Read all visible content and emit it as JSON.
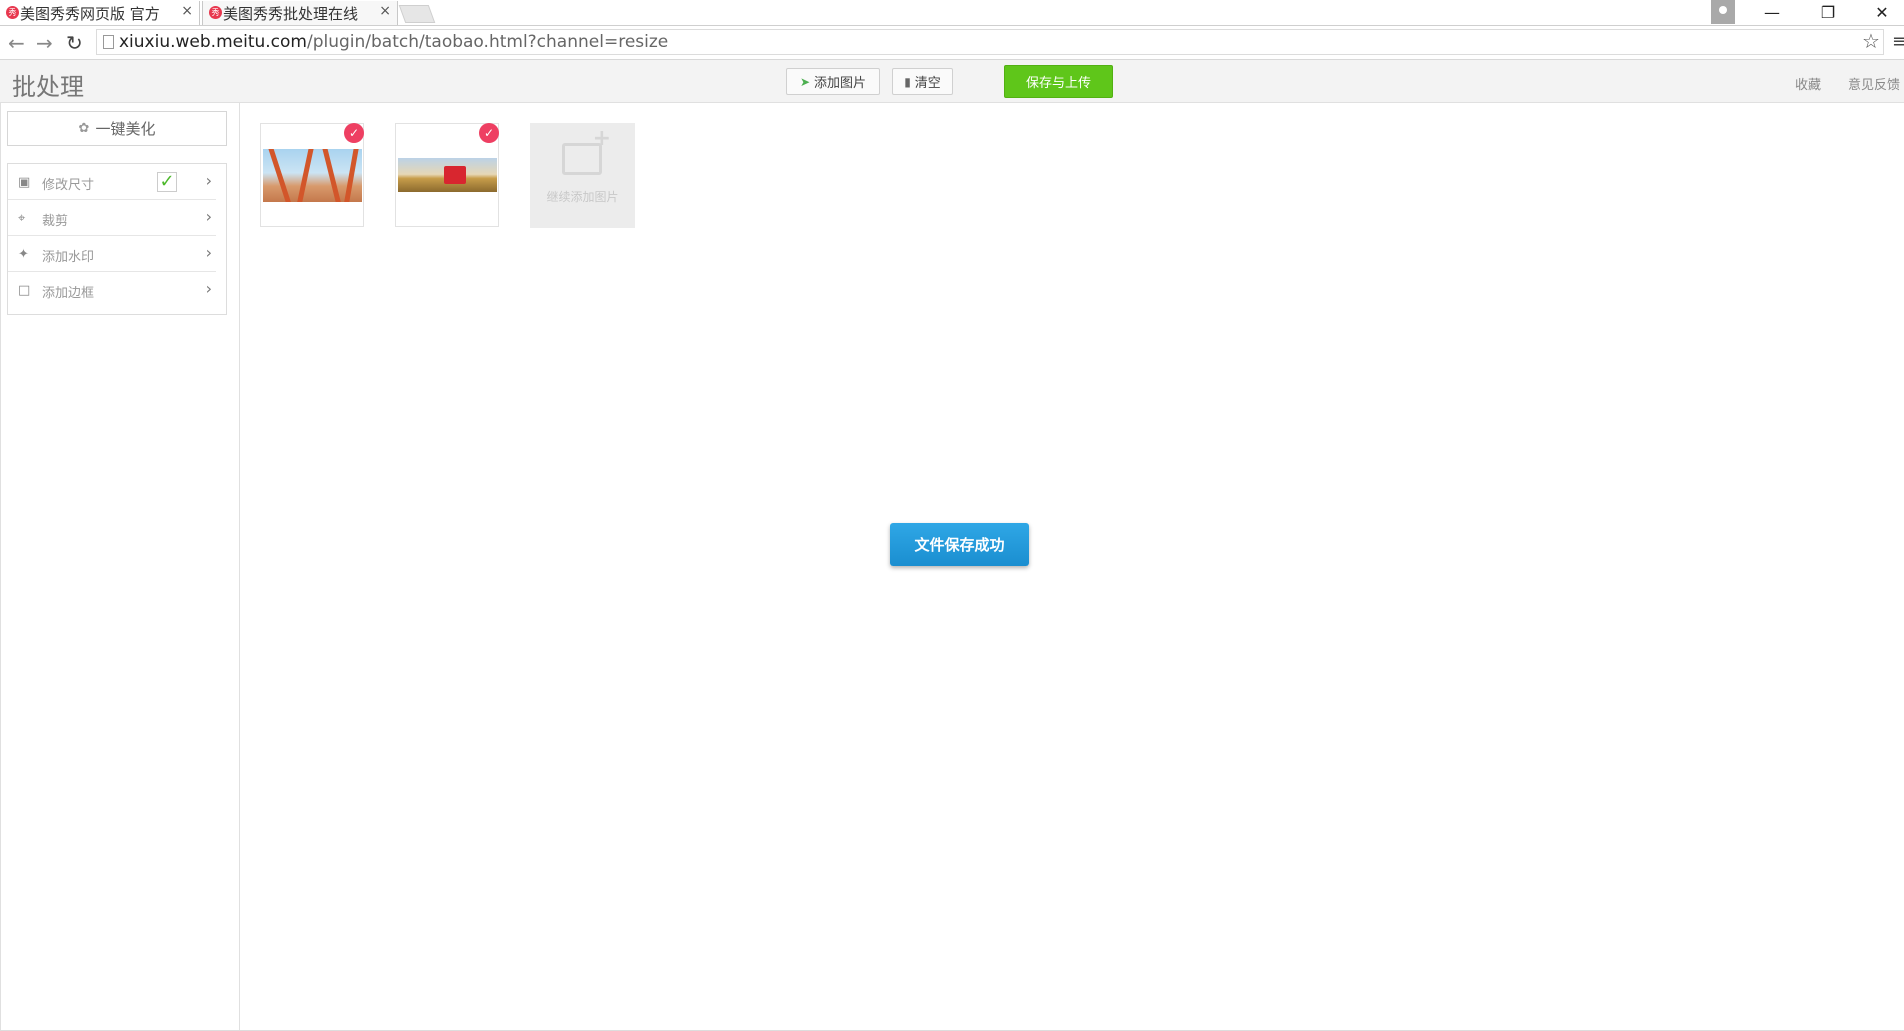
{
  "browser": {
    "tabs": [
      {
        "title": "美图秀秀网页版 官方",
        "favicon": "秀",
        "active": false
      },
      {
        "title": "美图秀秀批处理在线",
        "favicon": "秀",
        "active": true
      }
    ],
    "close_glyph": "×",
    "url_host": "xiuxiu.web.meitu.com",
    "url_path": "/plugin/batch/taobao.html?channel=resize",
    "icons": {
      "back": "back-arrow-icon",
      "forward": "forward-arrow-icon",
      "reload": "reload-icon",
      "bookmark": "star-icon",
      "menu": "hamburger-menu-icon"
    }
  },
  "app": {
    "title": "批处理",
    "toolbar": {
      "add_image": "添加图片",
      "clear": "清空",
      "save_upload": "保存与上传"
    },
    "header_links": {
      "favorite": "收藏",
      "feedback": "意见反馈"
    },
    "sidebar": {
      "beautify": "一键美化",
      "items": [
        {
          "label": "修改尺寸",
          "icon": "resize-icon",
          "checked": true
        },
        {
          "label": "裁剪",
          "icon": "crop-icon",
          "checked": false
        },
        {
          "label": "添加水印",
          "icon": "watermark-icon",
          "checked": false
        },
        {
          "label": "添加边框",
          "icon": "border-icon",
          "checked": false
        }
      ]
    },
    "images": [
      {
        "selected": true,
        "subject": "cranes"
      },
      {
        "selected": true,
        "subject": "red-truck"
      }
    ],
    "add_more_label": "继续添加图片",
    "toast": "文件保存成功",
    "colors": {
      "save_button": "#5fc61a",
      "toast": "#1f97da",
      "badge": "#ee3f62"
    }
  }
}
